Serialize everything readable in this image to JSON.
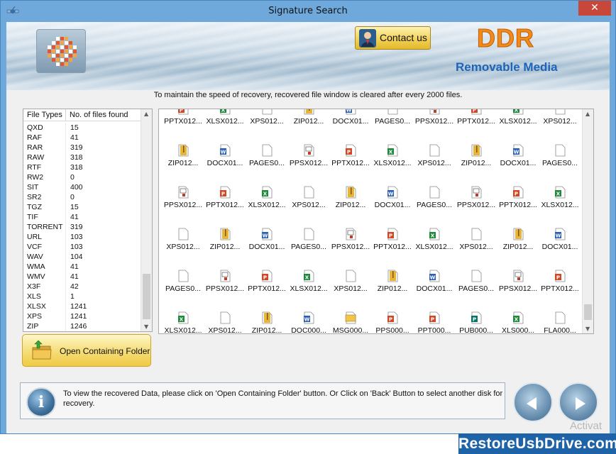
{
  "window": {
    "title": "Signature Search",
    "close_glyph": "✕"
  },
  "header": {
    "contact_label": "Contact us",
    "brand": "DDR",
    "tagline": "Removable Media"
  },
  "notice": "To maintain the speed of recovery, recovered file window is cleared after every 2000 files.",
  "file_types_table": {
    "columns": [
      "File Types",
      "No. of files found"
    ],
    "rows": [
      [
        "QXD",
        "15"
      ],
      [
        "RAF",
        "41"
      ],
      [
        "RAR",
        "319"
      ],
      [
        "RAW",
        "318"
      ],
      [
        "RTF",
        "318"
      ],
      [
        "RW2",
        "0"
      ],
      [
        "SIT",
        "400"
      ],
      [
        "SR2",
        "0"
      ],
      [
        "TGZ",
        "15"
      ],
      [
        "TIF",
        "41"
      ],
      [
        "TORRENT",
        "319"
      ],
      [
        "URL",
        "103"
      ],
      [
        "VCF",
        "103"
      ],
      [
        "WAV",
        "104"
      ],
      [
        "WMA",
        "41"
      ],
      [
        "WMV",
        "41"
      ],
      [
        "X3F",
        "42"
      ],
      [
        "XLS",
        "1"
      ],
      [
        "XLSX",
        "1241"
      ],
      [
        "XPS",
        "1241"
      ],
      [
        "ZIP",
        "1246"
      ]
    ]
  },
  "open_folder_label": "Open Containing Folder",
  "file_grid": {
    "rows": [
      [
        "PPTX012...",
        "XLSX012...",
        "XPS012...",
        "ZIP012...",
        "DOCX01...",
        "PAGES0...",
        "PPSX012...",
        "PPTX012...",
        "XLSX012...",
        "XPS012..."
      ],
      [
        "ZIP012...",
        "DOCX01...",
        "PAGES0...",
        "PPSX012...",
        "PPTX012...",
        "XLSX012...",
        "XPS012...",
        "ZIP012...",
        "DOCX01...",
        "PAGES0..."
      ],
      [
        "PPSX012...",
        "PPTX012...",
        "XLSX012...",
        "XPS012...",
        "ZIP012...",
        "DOCX01...",
        "PAGES0...",
        "PPSX012...",
        "PPTX012...",
        "XLSX012..."
      ],
      [
        "XPS012...",
        "ZIP012...",
        "DOCX01...",
        "PAGES0...",
        "PPSX012...",
        "PPTX012...",
        "XLSX012...",
        "XPS012...",
        "ZIP012...",
        "DOCX01..."
      ],
      [
        "PAGES0...",
        "PPSX012...",
        "PPTX012...",
        "XLSX012...",
        "XPS012...",
        "ZIP012...",
        "DOCX01...",
        "PAGES0...",
        "PPSX012...",
        "PPTX012..."
      ],
      [
        "XLSX012...",
        "XPS012...",
        "ZIP012...",
        "DOC000...",
        "MSG000...",
        "PPS000...",
        "PPT000...",
        "PUB000...",
        "XLS000...",
        "FLA000..."
      ]
    ],
    "icon_kinds": [
      [
        "pptx",
        "xlsx",
        "xps",
        "zip",
        "docx",
        "pages",
        "ppsx",
        "pptx",
        "xlsx",
        "xps"
      ],
      [
        "zip",
        "docx",
        "pages",
        "ppsx",
        "pptx",
        "xlsx",
        "xps",
        "zip",
        "docx",
        "pages"
      ],
      [
        "ppsx",
        "pptx",
        "xlsx",
        "xps",
        "zip",
        "docx",
        "pages",
        "ppsx",
        "pptx",
        "xlsx"
      ],
      [
        "xps",
        "zip",
        "docx",
        "pages",
        "ppsx",
        "pptx",
        "xlsx",
        "xps",
        "zip",
        "docx"
      ],
      [
        "pages",
        "ppsx",
        "pptx",
        "xlsx",
        "xps",
        "zip",
        "docx",
        "pages",
        "ppsx",
        "pptx"
      ],
      [
        "xlsx",
        "xps",
        "zip",
        "docx",
        "msg",
        "pps",
        "ppt",
        "pub",
        "xls",
        "fla"
      ]
    ]
  },
  "info": {
    "icon_glyph": "i",
    "text": "To view the recovered Data, please click on 'Open Containing Folder' button. Or Click on 'Back' Button to select another disk for recovery."
  },
  "watermark": "Activat",
  "site_brand": "RestoreUsbDrive.com",
  "colors": {
    "titlebar": "#6fa9dc",
    "close": "#c7473a",
    "brand_orange": "#f08a1c",
    "tagline_blue": "#1d64b8",
    "button_gold": "#f0cf52",
    "strip_blue": "#1e63a8"
  },
  "icons": {
    "title": "app-satellite-icon",
    "logo": "ddr-checker-logo",
    "contact": "user-avatar-icon",
    "folder": "folder-open-icon",
    "info": "info-icon",
    "back": "back-arrow-icon",
    "next": "next-arrow-icon"
  }
}
